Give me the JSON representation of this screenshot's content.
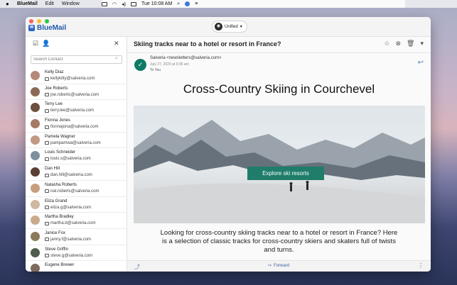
{
  "menubar": {
    "app": "BlueMail",
    "items": [
      "Edit",
      "Window"
    ],
    "clock": "Tue 10:08 AM"
  },
  "window": {
    "brand": "BlueMail",
    "account_selector": "Unified"
  },
  "contacts_panel": {
    "search_placeholder": "Search Contact",
    "contacts": [
      {
        "name": "Kelly Diaz",
        "email": "kellykitty@salveria.com",
        "avatar_color": "#b5897a"
      },
      {
        "name": "Joe Roberts",
        "email": "joe.roberts@salveria.com",
        "avatar_color": "#8b6a55"
      },
      {
        "name": "Terry Lee",
        "email": "terry.lee@salveria.com",
        "avatar_color": "#6d4f3f"
      },
      {
        "name": "Fionna Jones",
        "email": "fionnajona@salveria.com",
        "avatar_color": "#a47a63"
      },
      {
        "name": "Pamela Wagner",
        "email": "pampamwa@salveria.com",
        "avatar_color": "#c29a82"
      },
      {
        "name": "Louis Schneider",
        "email": "louis.s@salveria.com",
        "avatar_color": "#7f8f9f"
      },
      {
        "name": "Dan Hill",
        "email": "dan.hill@salveria.com",
        "avatar_color": "#5a4034"
      },
      {
        "name": "Natasha Roberts",
        "email": "nat.roberts@salveria.com",
        "avatar_color": "#c89e7e"
      },
      {
        "name": "Eliza Grand",
        "email": "eliza.g@salveria.com",
        "avatar_color": "#d0b7a2"
      },
      {
        "name": "Martha Bradley",
        "email": "martha.b@salveria.com",
        "avatar_color": "#c9ab8c"
      },
      {
        "name": "Janice Fox",
        "email": "janny.f@salveria.com",
        "avatar_color": "#8c7a5a"
      },
      {
        "name": "Steve Griffin",
        "email": "steve.g@salveria.com",
        "avatar_color": "#4f5d4f"
      },
      {
        "name": "Eugene Brewer",
        "email": "",
        "avatar_color": "#7d6b5d"
      }
    ]
  },
  "message": {
    "subject": "Skiing tracks near to a hotel or resort in France?",
    "sender": "Salveria <newsletters@salveria.com>",
    "date": "July 27, 2020 at 9:36 am",
    "to": "To You",
    "headline": "Cross-Country Skiing in Courchevel",
    "cta_label": "Explore ski resorts",
    "body": "Looking for cross-country skiing tracks near to a hotel or resort in France? Here is a selection of classic tracks for cross-country skiers and skaters full of twists and turns.",
    "forward_label": "Forward"
  },
  "colors": {
    "accent_teal": "#1f7d6a",
    "link_blue": "#3b65a3"
  }
}
